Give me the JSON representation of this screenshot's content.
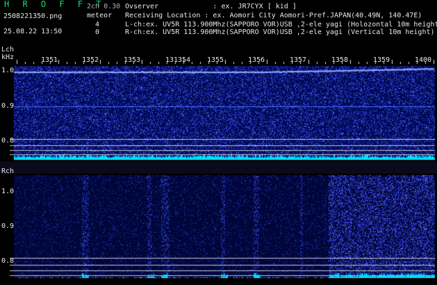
{
  "header": {
    "brand": "H R O F F T",
    "mode": "2ch 0.30",
    "filename": "2508221350.png",
    "datetime": "25.08.22 13:50",
    "meteor_label": "meteor",
    "lch_count": "4",
    "rch_count": "0",
    "observer": "Ovserver             : ex. JR7CYX [ kid ]",
    "location": "Receiving Location : ex. Aomori City Aomori-Pref.JAPAN(40.49N, 140.47E)",
    "lch_info": "L-ch:ex. UV5R 113.900Mhz(SAPPORO VOR)USB ,2-ele yagi (Holozontal 10m height)",
    "rch_info": "R-ch:ex. UV5R 113.900Mhz(SAPPORO VOR)USB ,2-ele yagi (Vertical 10m height)"
  },
  "lch": {
    "label": "Lch",
    "unit": "kHz",
    "y_labels": [
      "1.0",
      "0.9",
      "0.8"
    ]
  },
  "rch": {
    "label": "Rch",
    "y_labels": [
      "1.0",
      "0.9",
      "0.8"
    ]
  },
  "time_axis": {
    "ticks": [
      "1351",
      "1352",
      "1353",
      "13",
      "1354",
      "1355",
      "1356",
      "1357",
      "1358",
      "1359",
      "1400"
    ]
  },
  "colors": {
    "background": "#000000",
    "waterfall_base": "#000a55",
    "noise": "#3a4cff",
    "carrier": "#8fa8ff",
    "activity_bar": "#00e0ff",
    "brand": "#12e06e",
    "gridline": "#c8c8d8"
  }
}
